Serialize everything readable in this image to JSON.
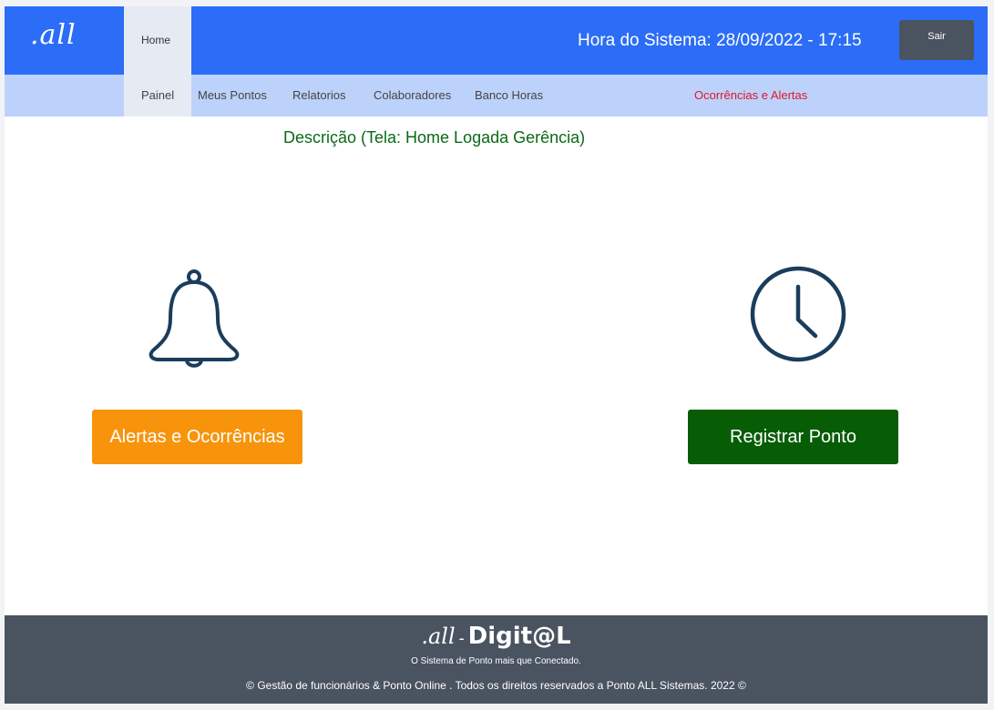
{
  "header": {
    "logo": ".all",
    "home_tab": "Home",
    "system_time": "Hora do Sistema: 28/09/2022  -  17:15",
    "logout_label": "Sair"
  },
  "subnav": {
    "items": [
      "Painel",
      "Meus Pontos",
      "Relatorios",
      "Colaboradores",
      "Banco Horas"
    ],
    "alert_link": "Ocorrências e Alertas"
  },
  "main": {
    "description": "Descrição (Tela:  Home Logada Gerência)",
    "alerts_button": "Alertas e Ocorrências",
    "register_button": "Registrar Ponto",
    "left_icon": "bell-icon",
    "right_icon": "clock-icon"
  },
  "footer": {
    "logo_script": ".all",
    "logo_separator": "-",
    "logo_brand": "Digit@L",
    "tagline": "O Sistema de Ponto mais que Conectado.",
    "copyright": "© Gestão de funcionários & Ponto Online .  Todos os direitos reservados a Ponto ALL Sistemas.  2022 ©"
  },
  "colors": {
    "topbar": "#2b6df6",
    "subnav": "#bdd2fb",
    "alerts_button": "#f7940c",
    "register_button": "#075d06",
    "footer": "#4a5360",
    "alert_link": "#e0162b",
    "description": "#0a6a18",
    "icon_stroke": "#1b3d5c"
  }
}
